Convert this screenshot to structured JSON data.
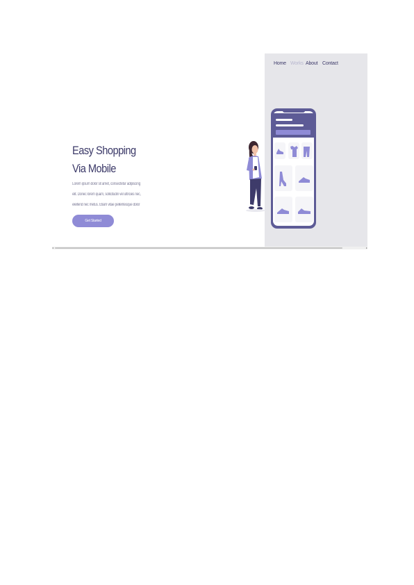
{
  "nav": {
    "home": "Home",
    "works": "Works",
    "about": "About",
    "contact": "Contact"
  },
  "hero": {
    "title_line1": "Easy Shopping",
    "title_line2": "Via Mobile",
    "body_line1": "Lorem ipsum dolor sit amet, consectetur adipiscing",
    "body_line2": "elit. Donec lorem quam, sollicitudin vel ultricies nec,",
    "body_line3": "eleifend nec metus. Etiam vitae pellentesque dolor",
    "cta_label": "Get Started"
  },
  "colors": {
    "accent": "#8f8bd6",
    "heading": "#3b3968",
    "panel": "#e6e6ea",
    "phone_frame": "#5d5b96"
  },
  "icons": {
    "illustration": "woman-holding-phone",
    "product_tiles": [
      "shoe-icon",
      "shirt-icon",
      "pants-icon",
      "boot-icon",
      "sneaker-icon",
      "sneaker-icon",
      "sneaker-icon"
    ]
  }
}
